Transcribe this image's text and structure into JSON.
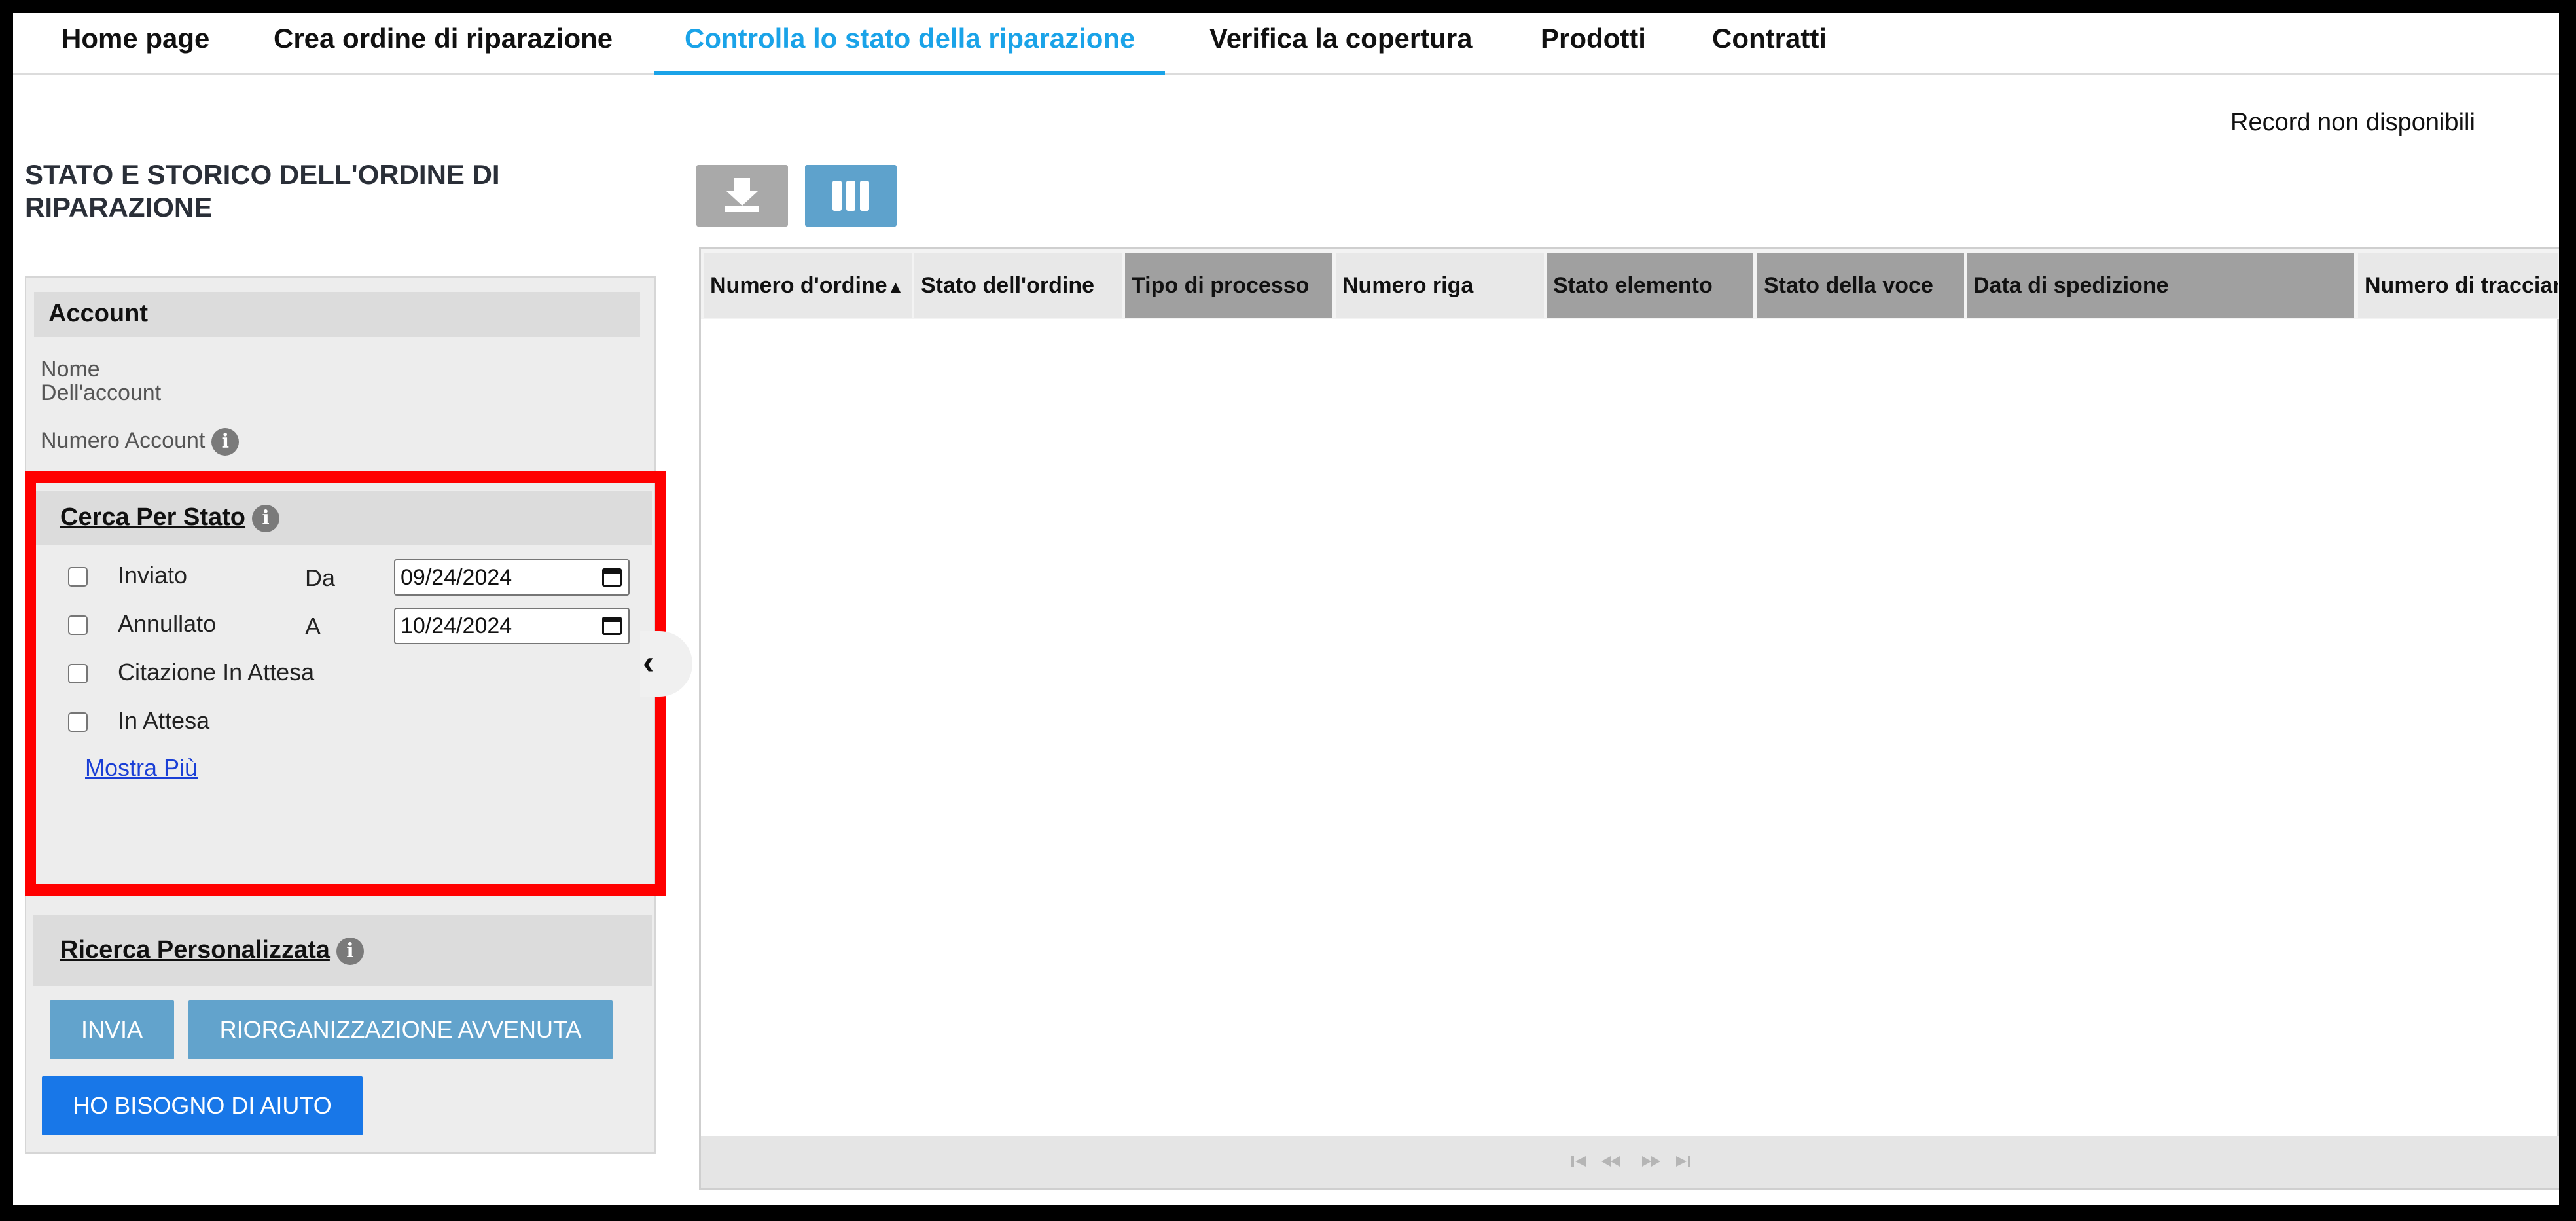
{
  "nav": {
    "tabs": [
      {
        "label": "Home page"
      },
      {
        "label": "Crea ordine di riparazione"
      },
      {
        "label": "Controlla lo stato della riparazione",
        "active": true
      },
      {
        "label": "Verifica la copertura"
      },
      {
        "label": "Prodotti"
      },
      {
        "label": "Contratti"
      }
    ],
    "active_color": "#1aa3e8"
  },
  "page": {
    "title": "STATO E STORICO DELL'ORDINE DI RIPARAZIONE",
    "records_status": "Record non disponibili"
  },
  "account": {
    "heading": "Account",
    "name_label": "Nome Dell'account",
    "number_label": "Numero Account",
    "info_icon": "info-icon"
  },
  "status_search": {
    "heading": "Cerca Per Stato",
    "highlight_color": "#ff0000",
    "checkboxes": [
      {
        "label": "Inviato",
        "checked": false
      },
      {
        "label": "Annullato",
        "checked": false
      },
      {
        "label": "Citazione In Attesa",
        "checked": false
      },
      {
        "label": "In Attesa",
        "checked": false
      }
    ],
    "from_label": "Da",
    "from_value": "09/24/2024",
    "to_label": "A",
    "to_value": "10/24/2024",
    "show_more": "Mostra Più"
  },
  "custom_search": {
    "heading": "Ricerca Personalizzata"
  },
  "buttons": {
    "submit": "INVIA",
    "reorganize": "RIORGANIZZAZIONE AVVENUTA",
    "help": "HO BISOGNO DI AIUTO"
  },
  "toolbar": {
    "download_icon": "download-icon",
    "columns_icon": "columns-icon"
  },
  "grid": {
    "columns": [
      {
        "label": "Numero d'ordine",
        "sorted": "asc"
      },
      {
        "label": "Stato dell'ordine"
      },
      {
        "label": "Tipo di processo"
      },
      {
        "label": "Numero riga"
      },
      {
        "label": "Stato elemento"
      },
      {
        "label": "Stato della voce"
      },
      {
        "label": "Data di spedizione"
      },
      {
        "label": "Numero di tracciamento"
      }
    ],
    "rows": []
  }
}
